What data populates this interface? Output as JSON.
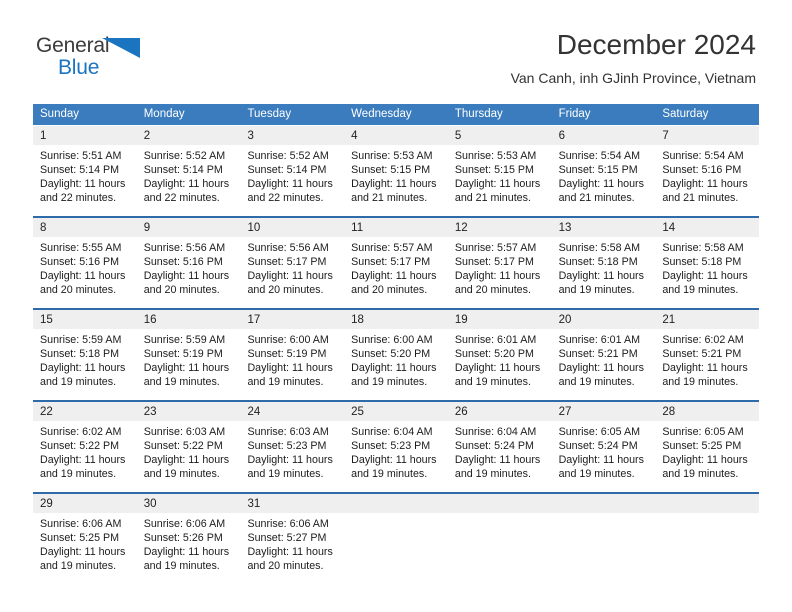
{
  "brand": {
    "name_part1": "General",
    "name_part2": "Blue",
    "triangle_icon": "triangle-icon",
    "accent_color": "#1a74c0"
  },
  "header": {
    "title": "December 2024",
    "subtitle": "Van Canh, inh GJinh Province, Vietnam"
  },
  "colors": {
    "header_blue": "#3a7cbd",
    "row_divider_blue": "#2d6ca8",
    "day_band_gray": "#efefef",
    "text": "#1c1c1c"
  },
  "calendar": {
    "weekday_headers": [
      "Sunday",
      "Monday",
      "Tuesday",
      "Wednesday",
      "Thursday",
      "Friday",
      "Saturday"
    ],
    "weeks": [
      [
        {
          "day": "1",
          "sunrise": "Sunrise: 5:51 AM",
          "sunset": "Sunset: 5:14 PM",
          "daylight_1": "Daylight: 11 hours",
          "daylight_2": "and 22 minutes."
        },
        {
          "day": "2",
          "sunrise": "Sunrise: 5:52 AM",
          "sunset": "Sunset: 5:14 PM",
          "daylight_1": "Daylight: 11 hours",
          "daylight_2": "and 22 minutes."
        },
        {
          "day": "3",
          "sunrise": "Sunrise: 5:52 AM",
          "sunset": "Sunset: 5:14 PM",
          "daylight_1": "Daylight: 11 hours",
          "daylight_2": "and 22 minutes."
        },
        {
          "day": "4",
          "sunrise": "Sunrise: 5:53 AM",
          "sunset": "Sunset: 5:15 PM",
          "daylight_1": "Daylight: 11 hours",
          "daylight_2": "and 21 minutes."
        },
        {
          "day": "5",
          "sunrise": "Sunrise: 5:53 AM",
          "sunset": "Sunset: 5:15 PM",
          "daylight_1": "Daylight: 11 hours",
          "daylight_2": "and 21 minutes."
        },
        {
          "day": "6",
          "sunrise": "Sunrise: 5:54 AM",
          "sunset": "Sunset: 5:15 PM",
          "daylight_1": "Daylight: 11 hours",
          "daylight_2": "and 21 minutes."
        },
        {
          "day": "7",
          "sunrise": "Sunrise: 5:54 AM",
          "sunset": "Sunset: 5:16 PM",
          "daylight_1": "Daylight: 11 hours",
          "daylight_2": "and 21 minutes."
        }
      ],
      [
        {
          "day": "8",
          "sunrise": "Sunrise: 5:55 AM",
          "sunset": "Sunset: 5:16 PM",
          "daylight_1": "Daylight: 11 hours",
          "daylight_2": "and 20 minutes."
        },
        {
          "day": "9",
          "sunrise": "Sunrise: 5:56 AM",
          "sunset": "Sunset: 5:16 PM",
          "daylight_1": "Daylight: 11 hours",
          "daylight_2": "and 20 minutes."
        },
        {
          "day": "10",
          "sunrise": "Sunrise: 5:56 AM",
          "sunset": "Sunset: 5:17 PM",
          "daylight_1": "Daylight: 11 hours",
          "daylight_2": "and 20 minutes."
        },
        {
          "day": "11",
          "sunrise": "Sunrise: 5:57 AM",
          "sunset": "Sunset: 5:17 PM",
          "daylight_1": "Daylight: 11 hours",
          "daylight_2": "and 20 minutes."
        },
        {
          "day": "12",
          "sunrise": "Sunrise: 5:57 AM",
          "sunset": "Sunset: 5:17 PM",
          "daylight_1": "Daylight: 11 hours",
          "daylight_2": "and 20 minutes."
        },
        {
          "day": "13",
          "sunrise": "Sunrise: 5:58 AM",
          "sunset": "Sunset: 5:18 PM",
          "daylight_1": "Daylight: 11 hours",
          "daylight_2": "and 19 minutes."
        },
        {
          "day": "14",
          "sunrise": "Sunrise: 5:58 AM",
          "sunset": "Sunset: 5:18 PM",
          "daylight_1": "Daylight: 11 hours",
          "daylight_2": "and 19 minutes."
        }
      ],
      [
        {
          "day": "15",
          "sunrise": "Sunrise: 5:59 AM",
          "sunset": "Sunset: 5:18 PM",
          "daylight_1": "Daylight: 11 hours",
          "daylight_2": "and 19 minutes."
        },
        {
          "day": "16",
          "sunrise": "Sunrise: 5:59 AM",
          "sunset": "Sunset: 5:19 PM",
          "daylight_1": "Daylight: 11 hours",
          "daylight_2": "and 19 minutes."
        },
        {
          "day": "17",
          "sunrise": "Sunrise: 6:00 AM",
          "sunset": "Sunset: 5:19 PM",
          "daylight_1": "Daylight: 11 hours",
          "daylight_2": "and 19 minutes."
        },
        {
          "day": "18",
          "sunrise": "Sunrise: 6:00 AM",
          "sunset": "Sunset: 5:20 PM",
          "daylight_1": "Daylight: 11 hours",
          "daylight_2": "and 19 minutes."
        },
        {
          "day": "19",
          "sunrise": "Sunrise: 6:01 AM",
          "sunset": "Sunset: 5:20 PM",
          "daylight_1": "Daylight: 11 hours",
          "daylight_2": "and 19 minutes."
        },
        {
          "day": "20",
          "sunrise": "Sunrise: 6:01 AM",
          "sunset": "Sunset: 5:21 PM",
          "daylight_1": "Daylight: 11 hours",
          "daylight_2": "and 19 minutes."
        },
        {
          "day": "21",
          "sunrise": "Sunrise: 6:02 AM",
          "sunset": "Sunset: 5:21 PM",
          "daylight_1": "Daylight: 11 hours",
          "daylight_2": "and 19 minutes."
        }
      ],
      [
        {
          "day": "22",
          "sunrise": "Sunrise: 6:02 AM",
          "sunset": "Sunset: 5:22 PM",
          "daylight_1": "Daylight: 11 hours",
          "daylight_2": "and 19 minutes."
        },
        {
          "day": "23",
          "sunrise": "Sunrise: 6:03 AM",
          "sunset": "Sunset: 5:22 PM",
          "daylight_1": "Daylight: 11 hours",
          "daylight_2": "and 19 minutes."
        },
        {
          "day": "24",
          "sunrise": "Sunrise: 6:03 AM",
          "sunset": "Sunset: 5:23 PM",
          "daylight_1": "Daylight: 11 hours",
          "daylight_2": "and 19 minutes."
        },
        {
          "day": "25",
          "sunrise": "Sunrise: 6:04 AM",
          "sunset": "Sunset: 5:23 PM",
          "daylight_1": "Daylight: 11 hours",
          "daylight_2": "and 19 minutes."
        },
        {
          "day": "26",
          "sunrise": "Sunrise: 6:04 AM",
          "sunset": "Sunset: 5:24 PM",
          "daylight_1": "Daylight: 11 hours",
          "daylight_2": "and 19 minutes."
        },
        {
          "day": "27",
          "sunrise": "Sunrise: 6:05 AM",
          "sunset": "Sunset: 5:24 PM",
          "daylight_1": "Daylight: 11 hours",
          "daylight_2": "and 19 minutes."
        },
        {
          "day": "28",
          "sunrise": "Sunrise: 6:05 AM",
          "sunset": "Sunset: 5:25 PM",
          "daylight_1": "Daylight: 11 hours",
          "daylight_2": "and 19 minutes."
        }
      ],
      [
        {
          "day": "29",
          "sunrise": "Sunrise: 6:06 AM",
          "sunset": "Sunset: 5:25 PM",
          "daylight_1": "Daylight: 11 hours",
          "daylight_2": "and 19 minutes."
        },
        {
          "day": "30",
          "sunrise": "Sunrise: 6:06 AM",
          "sunset": "Sunset: 5:26 PM",
          "daylight_1": "Daylight: 11 hours",
          "daylight_2": "and 19 minutes."
        },
        {
          "day": "31",
          "sunrise": "Sunrise: 6:06 AM",
          "sunset": "Sunset: 5:27 PM",
          "daylight_1": "Daylight: 11 hours",
          "daylight_2": "and 20 minutes."
        },
        {
          "day": "",
          "sunrise": "",
          "sunset": "",
          "daylight_1": "",
          "daylight_2": ""
        },
        {
          "day": "",
          "sunrise": "",
          "sunset": "",
          "daylight_1": "",
          "daylight_2": ""
        },
        {
          "day": "",
          "sunrise": "",
          "sunset": "",
          "daylight_1": "",
          "daylight_2": ""
        },
        {
          "day": "",
          "sunrise": "",
          "sunset": "",
          "daylight_1": "",
          "daylight_2": ""
        }
      ]
    ]
  }
}
